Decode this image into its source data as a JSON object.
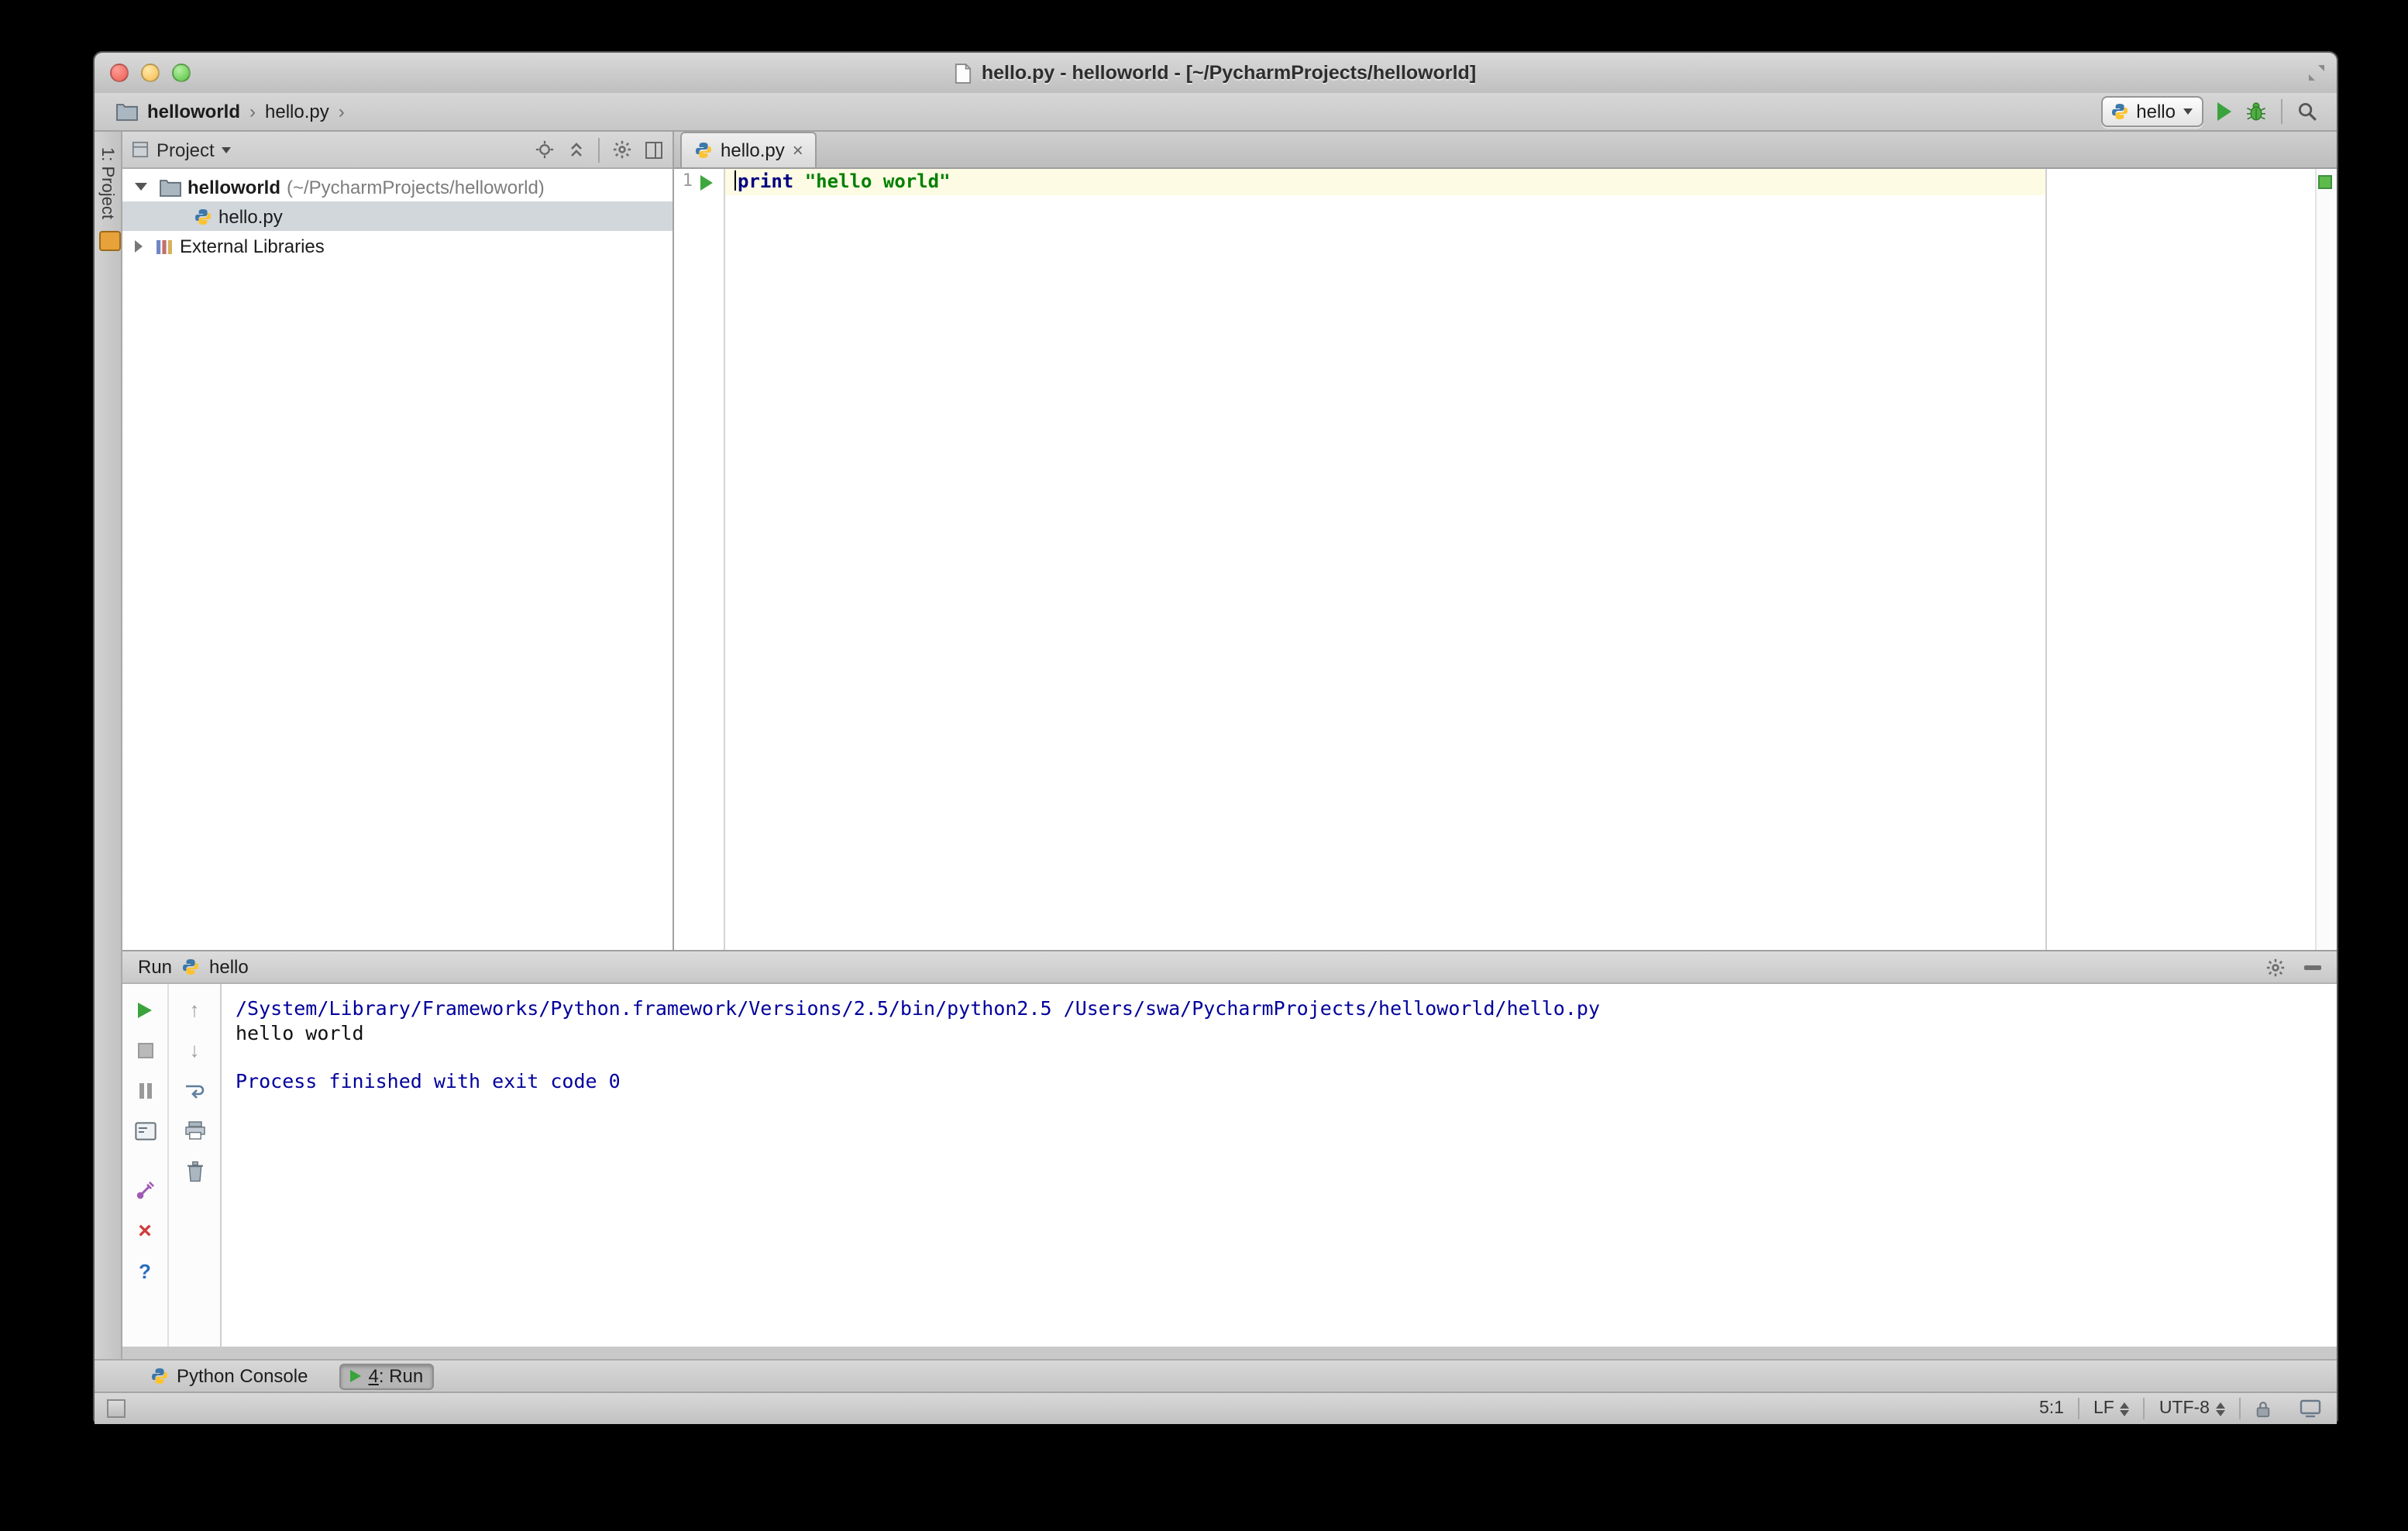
{
  "colors": {
    "run_green": "#3aa33c",
    "keyword_blue": "#000080",
    "string_green": "#008000",
    "console_system_blue": "#00009c",
    "selected_row_gray": "#d2d7dc",
    "current_line_yellow": "#fdfbe3",
    "annotation_ok_green": "#5dbb4d"
  },
  "titlebar": {
    "title": "hello.py - helloworld - [~/PycharmProjects/helloworld]"
  },
  "navbar": {
    "breadcrumb": {
      "project": "helloworld",
      "sep": "›",
      "file": "hello.py"
    },
    "run_config": {
      "name": "hello"
    }
  },
  "left_stripe": {
    "project_button": "1: Project"
  },
  "project_panel": {
    "header_title": "Project",
    "tree": {
      "root_name": "helloworld",
      "root_path": "(~/PycharmProjects/helloworld)",
      "file": "hello.py",
      "external_libraries": "External Libraries"
    }
  },
  "editor": {
    "tab_label": "hello.py",
    "line_number": "1",
    "code": {
      "keyword": "print",
      "string": "\"hello world\""
    }
  },
  "run_panel": {
    "title": "Run",
    "config_name": "hello",
    "console": {
      "line1": "/System/Library/Frameworks/Python.framework/Versions/2.5/bin/python2.5 /Users/swa/PycharmProjects/helloworld/hello.py",
      "line2": "hello world",
      "line3": "",
      "line4": "Process finished with exit code 0"
    }
  },
  "bottom_bar": {
    "python_console_label": "Python Console",
    "run_tab": {
      "mnemonic": "4",
      "rest": ": Run"
    }
  },
  "status_bar": {
    "caret_position": "5:1",
    "line_separator": "LF",
    "encoding": "UTF-8"
  }
}
